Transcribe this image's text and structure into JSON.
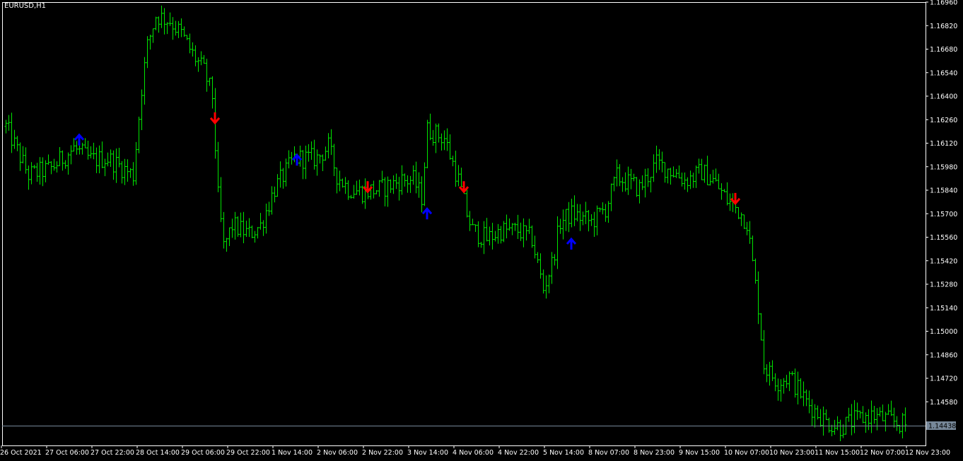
{
  "chart_data": {
    "type": "ohlc",
    "symbol_label": "EURUSD,H1",
    "current_price": 1.14438,
    "current_price_label": "1.14438",
    "ylim": [
      1.1432,
      1.1696
    ],
    "y_ticks": [
      "1.16960",
      "1.16820",
      "1.16680",
      "1.16540",
      "1.16400",
      "1.16260",
      "1.16120",
      "1.15980",
      "1.15840",
      "1.15700",
      "1.15560",
      "1.15420",
      "1.15280",
      "1.15140",
      "1.15000",
      "1.14860",
      "1.14720",
      "1.14580"
    ],
    "x_ticks": [
      {
        "bar": 0,
        "label": "26 Oct 2021"
      },
      {
        "bar": 16,
        "label": "27 Oct 06:00"
      },
      {
        "bar": 32,
        "label": "27 Oct 22:00"
      },
      {
        "bar": 48,
        "label": "28 Oct 14:00"
      },
      {
        "bar": 64,
        "label": "29 Oct 06:00"
      },
      {
        "bar": 80,
        "label": "29 Oct 22:00"
      },
      {
        "bar": 96,
        "label": "1 Nov 14:00"
      },
      {
        "bar": 112,
        "label": "2 Nov 06:00"
      },
      {
        "bar": 128,
        "label": "2 Nov 22:00"
      },
      {
        "bar": 144,
        "label": "3 Nov 14:00"
      },
      {
        "bar": 160,
        "label": "4 Nov 06:00"
      },
      {
        "bar": 176,
        "label": "4 Nov 22:00"
      },
      {
        "bar": 192,
        "label": "5 Nov 14:00"
      },
      {
        "bar": 208,
        "label": "8 Nov 07:00"
      },
      {
        "bar": 224,
        "label": "8 Nov 23:00"
      },
      {
        "bar": 240,
        "label": "9 Nov 15:00"
      },
      {
        "bar": 256,
        "label": "10 Nov 07:00"
      },
      {
        "bar": 272,
        "label": "10 Nov 23:00"
      },
      {
        "bar": 288,
        "label": "11 Nov 15:00"
      },
      {
        "bar": 304,
        "label": "12 Nov 07:00"
      },
      {
        "bar": 320,
        "label": "12 Nov 23:00"
      }
    ],
    "keypoints": [
      [
        0,
        1.1622
      ],
      [
        8,
        1.1593
      ],
      [
        16,
        1.1597
      ],
      [
        24,
        1.1609
      ],
      [
        30,
        1.1602
      ],
      [
        36,
        1.1603
      ],
      [
        45,
        1.1593
      ],
      [
        48,
        1.1645
      ],
      [
        50,
        1.167
      ],
      [
        53,
        1.1688
      ],
      [
        58,
        1.1685
      ],
      [
        62,
        1.1677
      ],
      [
        66,
        1.1665
      ],
      [
        70,
        1.1655
      ],
      [
        73,
        1.164
      ],
      [
        75,
        1.158
      ],
      [
        77,
        1.155
      ],
      [
        80,
        1.1563
      ],
      [
        86,
        1.1558
      ],
      [
        90,
        1.1563
      ],
      [
        95,
        1.1585
      ],
      [
        99,
        1.1595
      ],
      [
        102,
        1.1603
      ],
      [
        110,
        1.1603
      ],
      [
        114,
        1.161
      ],
      [
        117,
        1.1593
      ],
      [
        121,
        1.1585
      ],
      [
        126,
        1.1583
      ],
      [
        133,
        1.1585
      ],
      [
        140,
        1.159
      ],
      [
        144,
        1.159
      ],
      [
        147,
        1.158
      ],
      [
        149,
        1.162
      ],
      [
        155,
        1.1615
      ],
      [
        160,
        1.159
      ],
      [
        163,
        1.157
      ],
      [
        165,
        1.156
      ],
      [
        170,
        1.1555
      ],
      [
        175,
        1.156
      ],
      [
        181,
        1.156
      ],
      [
        186,
        1.1555
      ],
      [
        190,
        1.1525
      ],
      [
        193,
        1.154
      ],
      [
        196,
        1.1565
      ],
      [
        200,
        1.157
      ],
      [
        207,
        1.1565
      ],
      [
        212,
        1.1573
      ],
      [
        216,
        1.1592
      ],
      [
        224,
        1.1585
      ],
      [
        230,
        1.16
      ],
      [
        236,
        1.1595
      ],
      [
        240,
        1.159
      ],
      [
        243,
        1.1592
      ],
      [
        246,
        1.1595
      ],
      [
        250,
        1.159
      ],
      [
        255,
        1.1578
      ],
      [
        259,
        1.1572
      ],
      [
        262,
        1.1565
      ],
      [
        264,
        1.154
      ],
      [
        266,
        1.1515
      ],
      [
        268,
        1.148
      ],
      [
        270,
        1.1475
      ],
      [
        273,
        1.147
      ],
      [
        277,
        1.1473
      ],
      [
        283,
        1.1458
      ],
      [
        290,
        1.1446
      ],
      [
        295,
        1.1443
      ],
      [
        300,
        1.1447
      ],
      [
        306,
        1.145
      ],
      [
        312,
        1.1447
      ],
      [
        318,
        1.1444
      ]
    ],
    "bar_range": 0.0011,
    "bar_count": 319,
    "signals": [
      {
        "bar": 26,
        "price": 1.1614,
        "direction": "up",
        "color": "#0000ff"
      },
      {
        "bar": 74,
        "price": 1.1627,
        "direction": "down",
        "color": "#ff0000"
      },
      {
        "bar": 103,
        "price": 1.1602,
        "direction": "up",
        "color": "#0000ff"
      },
      {
        "bar": 128,
        "price": 1.1586,
        "direction": "down",
        "color": "#ff0000"
      },
      {
        "bar": 149,
        "price": 1.157,
        "direction": "up",
        "color": "#0000ff"
      },
      {
        "bar": 162,
        "price": 1.1586,
        "direction": "down",
        "color": "#ff0000"
      },
      {
        "bar": 200,
        "price": 1.1552,
        "direction": "up",
        "color": "#0000ff"
      },
      {
        "bar": 258,
        "price": 1.1579,
        "direction": "down",
        "color": "#ff0000"
      }
    ],
    "colors": {
      "background": "#000000",
      "bars": "#00e600",
      "frame": "#ffffff",
      "price_line": "#778899",
      "price_label_bg": "#778899",
      "text": "#ffffff"
    }
  }
}
